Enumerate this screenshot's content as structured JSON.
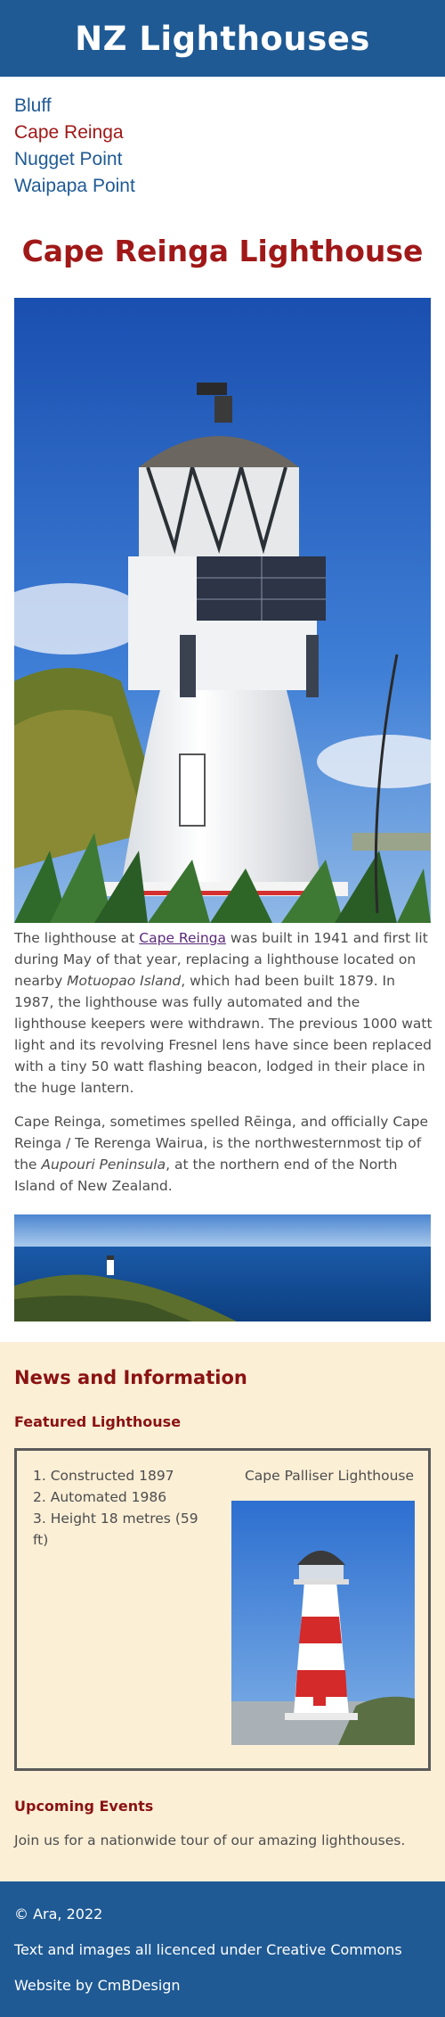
{
  "site": {
    "title": "NZ Lighthouses"
  },
  "nav": {
    "items": [
      {
        "label": "Bluff"
      },
      {
        "label": "Cape Reinga"
      },
      {
        "label": "Nugget Point"
      },
      {
        "label": "Waipapa Point"
      }
    ]
  },
  "main": {
    "title": "Cape Reinga Lighthouse",
    "p1": {
      "t1": "The lighthouse at ",
      "link": "Cape Reinga",
      "t2": " was built in 1941 and first lit during May of that year, replacing a lighthouse located on nearby ",
      "em": "Motuopao Island",
      "t3": ", which had been built 1879. In 1987, the lighthouse was fully automated and the lighthouse keepers were withdrawn. The previous 1000 watt light and its revolving Fresnel lens have since been replaced with a tiny 50 watt flashing beacon, lodged in their place in the huge lantern."
    },
    "p2": {
      "t1": "Cape Reinga, sometimes spelled Rēinga, and officially Cape Reinga / Te Rerenga Wairua, is the northwesternmost tip of the ",
      "em": "Aupouri Peninsula",
      "t2": ", at the northern end of the North Island of New Zealand."
    }
  },
  "news": {
    "heading": "News and Information",
    "featured_heading": "Featured Lighthouse",
    "facts": [
      "1. Constructed 1897",
      "2. Automated 1986",
      "3. Height 18 metres (59 ft)"
    ],
    "featured_caption": "Cape Palliser Lighthouse",
    "events_heading": "Upcoming Events",
    "events_text": "Join us for a nationwide tour of our amazing lighthouses."
  },
  "footer": {
    "copyright": "© Ara, 2022",
    "licence": "Text and images all licenced under Creative Commons",
    "credit": "Website by CmBDesign"
  },
  "colors": {
    "header_bg": "#1f5a94",
    "accent_red": "#a01818",
    "news_bg": "#fbefd6"
  }
}
